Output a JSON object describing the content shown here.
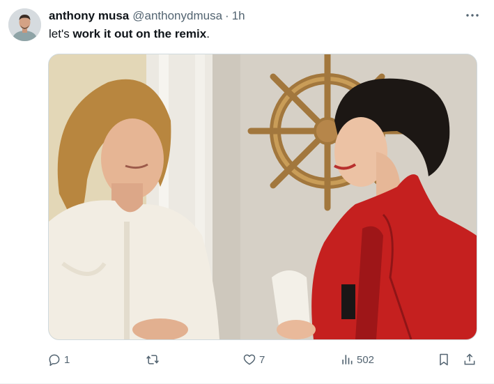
{
  "tweet": {
    "author": {
      "display_name": "anthony musa",
      "handle": "@anthonydmusa",
      "separator": "·",
      "time": "1h"
    },
    "text": {
      "prefix": "let's ",
      "bold": "work it out on the remix",
      "suffix": "."
    },
    "media": {
      "alt": "photo"
    },
    "actions": {
      "reply": {
        "icon": "reply-icon",
        "count": "1"
      },
      "retweet": {
        "icon": "retweet-icon",
        "count": ""
      },
      "like": {
        "icon": "heart-icon",
        "count": "7"
      },
      "views": {
        "icon": "views-icon",
        "count": "502"
      },
      "bookmark": {
        "icon": "bookmark-icon"
      },
      "share": {
        "icon": "share-icon"
      }
    },
    "more_icon": "more-icon"
  },
  "colors": {
    "text": "#0f1419",
    "secondary": "#536471",
    "border": "#cfd9de"
  }
}
